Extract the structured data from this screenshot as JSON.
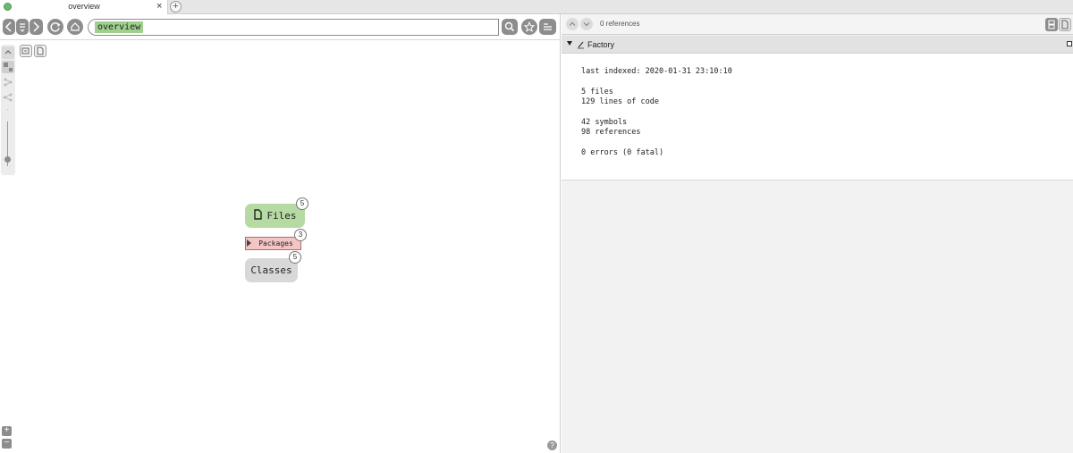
{
  "tab": {
    "title": "overview",
    "close_label": "×",
    "new_tab_label": "+"
  },
  "navbar": {
    "search_token": "overview"
  },
  "graph": {
    "nodes": [
      {
        "label": "Files",
        "count": "5",
        "color": "#b5dba3"
      },
      {
        "label": "Packages",
        "count": "3",
        "color": "#f4c5c5"
      },
      {
        "label": "Classes",
        "count": "5",
        "color": "#d8d8d8"
      }
    ]
  },
  "zoom": {
    "in_label": "+",
    "out_label": "−"
  },
  "help": {
    "label": "?"
  },
  "references": {
    "count_label": "0 references"
  },
  "project": {
    "name": "Factory",
    "last_indexed": "last indexed: 2020-01-31 23:10:10",
    "files": "5 files",
    "lines": "129 lines of code",
    "symbols": "42 symbols",
    "references": "98 references",
    "errors": "0 errors (0 fatal)"
  },
  "colors": {
    "accent_green": "#9fd08e",
    "button_gray": "#8d8d8d"
  }
}
